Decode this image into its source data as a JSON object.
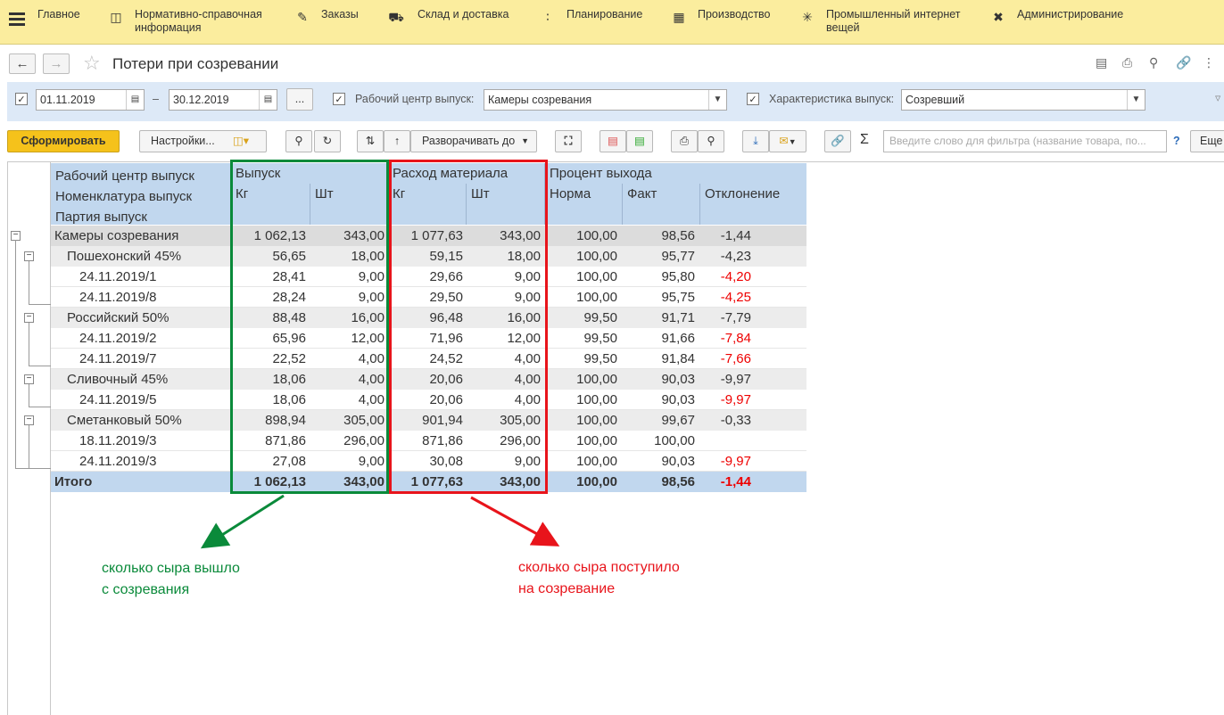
{
  "menu": {
    "sections": [
      {
        "label": "Главное",
        "icon": "menu-icon"
      },
      {
        "label": "Нормативно-справочная информация",
        "icon": "document-icon"
      },
      {
        "label": "Заказы",
        "icon": "orders-icon"
      },
      {
        "label": "Склад и доставка",
        "icon": "truck-icon"
      },
      {
        "label": "Планирование",
        "icon": "dots-icon"
      },
      {
        "label": "Производство",
        "icon": "factory-icon"
      },
      {
        "label": "Промышленный интернет вещей",
        "icon": "iot-icon"
      },
      {
        "label": "Администрирование",
        "icon": "tools-icon"
      }
    ]
  },
  "window": {
    "title": "Потери при созревании"
  },
  "filters": {
    "date_from": "01.11.2019",
    "date_sep": "–",
    "date_to": "30.12.2019",
    "ellipsis": "...",
    "work_center_label": "Рабочий центр выпуск:",
    "work_center_value": "Камеры созревания",
    "characteristic_label": "Характеристика выпуск:",
    "characteristic_value": "Созревший"
  },
  "toolbar": {
    "generate": "Сформировать",
    "settings": "Настройки...",
    "expand": "Разворачивать до",
    "search_placeholder": "Введите слово для фильтра (название товара, по...",
    "help": "?",
    "more": "Еще"
  },
  "table": {
    "header": {
      "group_line1": "Рабочий центр выпуск",
      "group_line2": "Номенклатура выпуск",
      "group_line3": "Партия выпуск",
      "output": "Выпуск",
      "consumption": "Расход материала",
      "yield": "Процент выхода",
      "kg": "Кг",
      "pcs": "Шт",
      "norm": "Норма",
      "fact": "Факт",
      "deviation": "Отклонение"
    },
    "rows": [
      {
        "name": "Камеры созревания",
        "out_kg": "1 062,13",
        "out_pcs": "343,00",
        "in_kg": "1 077,63",
        "in_pcs": "343,00",
        "norm": "100,00",
        "fact": "98,56",
        "dev": "-1,44",
        "level": 0,
        "neg": false
      },
      {
        "name": "Пошехонский 45%",
        "out_kg": "56,65",
        "out_pcs": "18,00",
        "in_kg": "59,15",
        "in_pcs": "18,00",
        "norm": "100,00",
        "fact": "95,77",
        "dev": "-4,23",
        "level": 1,
        "neg": false
      },
      {
        "name": "24.11.2019/1",
        "out_kg": "28,41",
        "out_pcs": "9,00",
        "in_kg": "29,66",
        "in_pcs": "9,00",
        "norm": "100,00",
        "fact": "95,80",
        "dev": "-4,20",
        "level": 2,
        "neg": true
      },
      {
        "name": "24.11.2019/8",
        "out_kg": "28,24",
        "out_pcs": "9,00",
        "in_kg": "29,50",
        "in_pcs": "9,00",
        "norm": "100,00",
        "fact": "95,75",
        "dev": "-4,25",
        "level": 2,
        "neg": true
      },
      {
        "name": "Российский 50%",
        "out_kg": "88,48",
        "out_pcs": "16,00",
        "in_kg": "96,48",
        "in_pcs": "16,00",
        "norm": "99,50",
        "fact": "91,71",
        "dev": "-7,79",
        "level": 1,
        "neg": false
      },
      {
        "name": "24.11.2019/2",
        "out_kg": "65,96",
        "out_pcs": "12,00",
        "in_kg": "71,96",
        "in_pcs": "12,00",
        "norm": "99,50",
        "fact": "91,66",
        "dev": "-7,84",
        "level": 2,
        "neg": true
      },
      {
        "name": "24.11.2019/7",
        "out_kg": "22,52",
        "out_pcs": "4,00",
        "in_kg": "24,52",
        "in_pcs": "4,00",
        "norm": "99,50",
        "fact": "91,84",
        "dev": "-7,66",
        "level": 2,
        "neg": true
      },
      {
        "name": "Сливочный 45%",
        "out_kg": "18,06",
        "out_pcs": "4,00",
        "in_kg": "20,06",
        "in_pcs": "4,00",
        "norm": "100,00",
        "fact": "90,03",
        "dev": "-9,97",
        "level": 1,
        "neg": false
      },
      {
        "name": "24.11.2019/5",
        "out_kg": "18,06",
        "out_pcs": "4,00",
        "in_kg": "20,06",
        "in_pcs": "4,00",
        "norm": "100,00",
        "fact": "90,03",
        "dev": "-9,97",
        "level": 2,
        "neg": true
      },
      {
        "name": "Сметанковый 50%",
        "out_kg": "898,94",
        "out_pcs": "305,00",
        "in_kg": "901,94",
        "in_pcs": "305,00",
        "norm": "100,00",
        "fact": "99,67",
        "dev": "-0,33",
        "level": 1,
        "neg": false
      },
      {
        "name": "18.11.2019/3",
        "out_kg": "871,86",
        "out_pcs": "296,00",
        "in_kg": "871,86",
        "in_pcs": "296,00",
        "norm": "100,00",
        "fact": "100,00",
        "dev": "",
        "level": 2,
        "neg": false
      },
      {
        "name": "24.11.2019/3",
        "out_kg": "27,08",
        "out_pcs": "9,00",
        "in_kg": "30,08",
        "in_pcs": "9,00",
        "norm": "100,00",
        "fact": "90,03",
        "dev": "-9,97",
        "level": 2,
        "neg": true
      }
    ],
    "total": {
      "name": "Итого",
      "out_kg": "1 062,13",
      "out_pcs": "343,00",
      "in_kg": "1 077,63",
      "in_pcs": "343,00",
      "norm": "100,00",
      "fact": "98,56",
      "dev": "-1,44"
    }
  },
  "annotations": {
    "green_line1": "сколько сыра вышло",
    "green_line2": "с созревания",
    "red_line1": "сколько сыра поступило",
    "red_line2": "на созревание",
    "green_color": "#0a8a3a",
    "red_color": "#e8141b"
  }
}
